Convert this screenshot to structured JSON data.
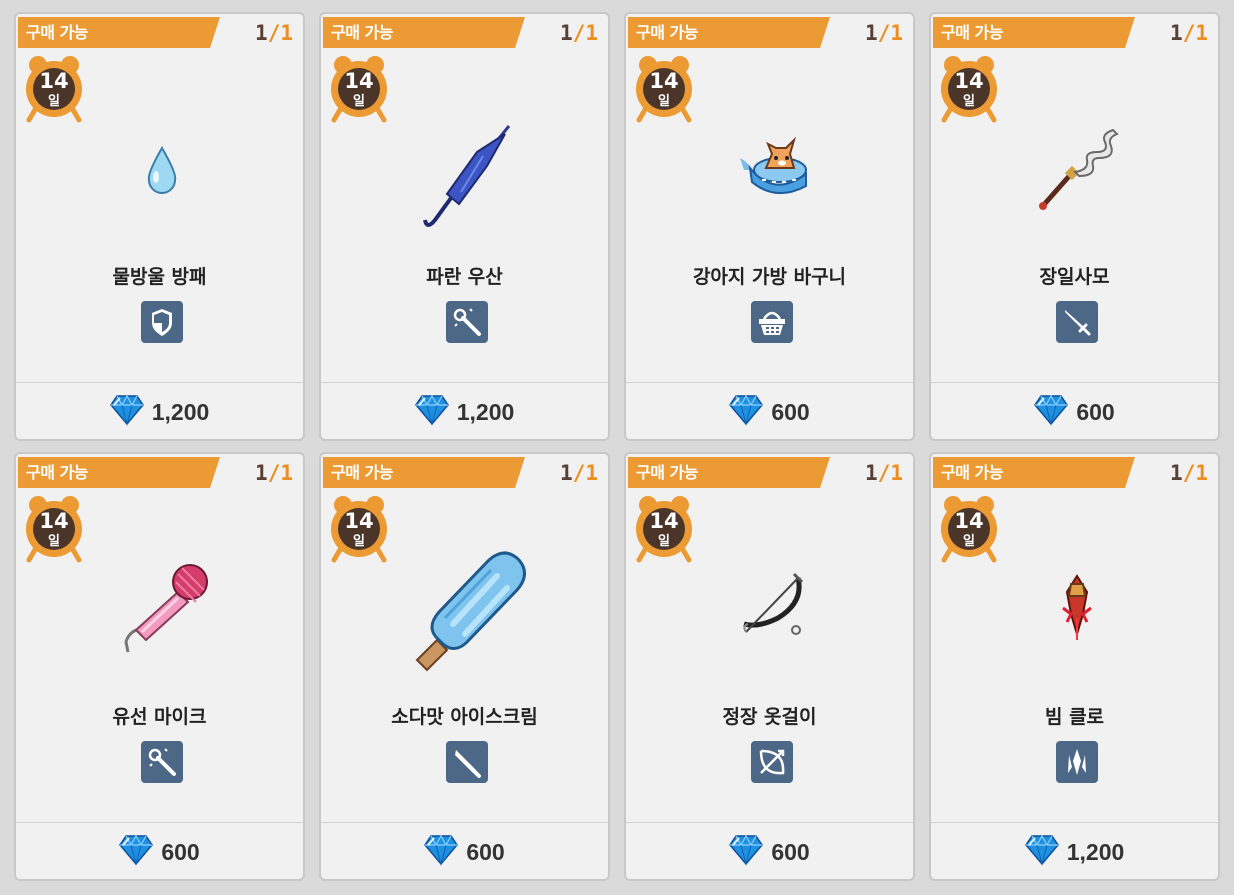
{
  "colors": {
    "badge": "#ec9a33",
    "count_used": "#5a4032",
    "count_total": "#ec8f22",
    "type_icon_bg": "#4d6786",
    "gem": "#1f8fe0"
  },
  "items": [
    {
      "badge": "구매 가능",
      "count_left": "1",
      "count_sep": "/",
      "count_right": "1",
      "days_num": "14",
      "days_unit": "일",
      "name": "물방울 방패",
      "type_icon": "shield-icon",
      "item_image": "water-droplet",
      "currency_icon": "gem-icon",
      "price": "1,200"
    },
    {
      "badge": "구매 가능",
      "count_left": "1",
      "count_sep": "/",
      "count_right": "1",
      "days_num": "14",
      "days_unit": "일",
      "name": "파란 우산",
      "type_icon": "wand-icon",
      "item_image": "blue-umbrella",
      "currency_icon": "gem-icon",
      "price": "1,200"
    },
    {
      "badge": "구매 가능",
      "count_left": "1",
      "count_sep": "/",
      "count_right": "1",
      "days_num": "14",
      "days_unit": "일",
      "name": "강아지 가방 바구니",
      "type_icon": "basket-icon",
      "item_image": "dog-basket-bag",
      "currency_icon": "gem-icon",
      "price": "600"
    },
    {
      "badge": "구매 가능",
      "count_left": "1",
      "count_sep": "/",
      "count_right": "1",
      "days_num": "14",
      "days_unit": "일",
      "name": "장일사모",
      "type_icon": "sword-icon",
      "item_image": "serpent-spear",
      "currency_icon": "gem-icon",
      "price": "600"
    },
    {
      "badge": "구매 가능",
      "count_left": "1",
      "count_sep": "/",
      "count_right": "1",
      "days_num": "14",
      "days_unit": "일",
      "name": "유선 마이크",
      "type_icon": "wand-icon",
      "item_image": "pink-microphone",
      "currency_icon": "gem-icon",
      "price": "600"
    },
    {
      "badge": "구매 가능",
      "count_left": "1",
      "count_sep": "/",
      "count_right": "1",
      "days_num": "14",
      "days_unit": "일",
      "name": "소다맛 아이스크림",
      "type_icon": "blade-icon",
      "item_image": "soda-popsicle",
      "currency_icon": "gem-icon",
      "price": "600"
    },
    {
      "badge": "구매 가능",
      "count_left": "1",
      "count_sep": "/",
      "count_right": "1",
      "days_num": "14",
      "days_unit": "일",
      "name": "정장 옷걸이",
      "type_icon": "bow-icon",
      "item_image": "hanger-bow",
      "currency_icon": "gem-icon",
      "price": "600"
    },
    {
      "badge": "구매 가능",
      "count_left": "1",
      "count_sep": "/",
      "count_right": "1",
      "days_num": "14",
      "days_unit": "일",
      "name": "빔 클로",
      "type_icon": "claw-icon",
      "item_image": "beam-claw",
      "currency_icon": "gem-icon",
      "price": "1,200"
    }
  ]
}
